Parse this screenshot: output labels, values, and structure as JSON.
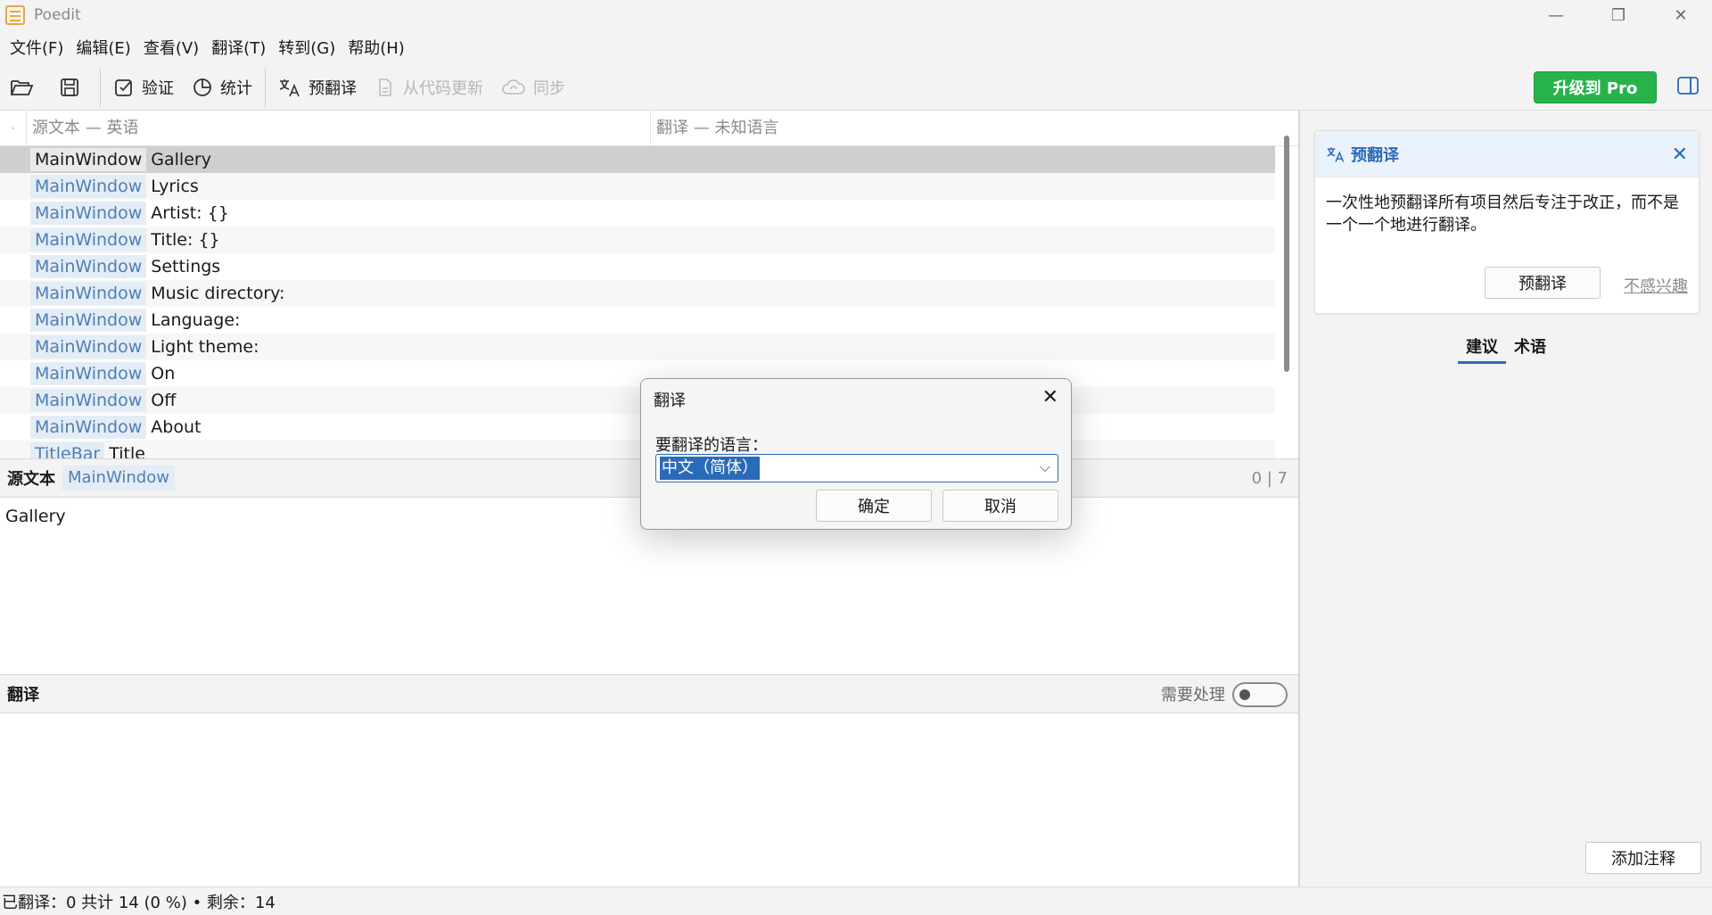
{
  "window": {
    "title": "Poedit",
    "minimize_glyph": "—",
    "restore_glyph": "❐",
    "close_glyph": "✕"
  },
  "menu": [
    {
      "label": "文件(F)"
    },
    {
      "label": "编辑(E)"
    },
    {
      "label": "查看(V)"
    },
    {
      "label": "翻译(T)"
    },
    {
      "label": "转到(G)"
    },
    {
      "label": "帮助(H)"
    }
  ],
  "toolbar": {
    "validate": "验证",
    "stats": "统计",
    "pretranslate": "预翻译",
    "update_from_code": "从代码更新",
    "sync": "同步",
    "upgrade": "升级到 Pro"
  },
  "list": {
    "dot": "·",
    "col_source": "源文本 — 英语",
    "col_translation": "翻译 — 未知语言",
    "rows": [
      {
        "context": "MainWindow",
        "source": "Gallery"
      },
      {
        "context": "MainWindow",
        "source": "Lyrics"
      },
      {
        "context": "MainWindow",
        "source": "Artist: {}"
      },
      {
        "context": "MainWindow",
        "source": "Title: {}"
      },
      {
        "context": "MainWindow",
        "source": "Settings"
      },
      {
        "context": "MainWindow",
        "source": "Music directory:"
      },
      {
        "context": "MainWindow",
        "source": "Language:"
      },
      {
        "context": "MainWindow",
        "source": "Light theme:"
      },
      {
        "context": "MainWindow",
        "source": "On"
      },
      {
        "context": "MainWindow",
        "source": "Off"
      },
      {
        "context": "MainWindow",
        "source": "About"
      },
      {
        "context": "TitleBar",
        "source": "Title"
      }
    ]
  },
  "source_panel": {
    "label": "源文本",
    "context": "MainWindow",
    "count": "0 | 7",
    "text": "Gallery"
  },
  "translation_panel": {
    "label": "翻译",
    "needs_work": "需要处理"
  },
  "sidebar": {
    "card_title": "预翻译",
    "card_close": "✕",
    "card_text": "一次性地预翻译所有项目然后专注于改正，而不是一个一个地进行翻译。",
    "card_button": "预翻译",
    "card_dismiss": "不感兴趣",
    "tab_suggestions": "建议",
    "tab_terms": "术语",
    "add_comment": "添加注释"
  },
  "status": {
    "text": "已翻译：0 共计 14 (0 %) • 剩余：14"
  },
  "dialog": {
    "title": "翻译",
    "close": "✕",
    "label": "要翻译的语言：",
    "selected_language": "中文（简体）",
    "arrow": "⌵",
    "ok": "确定",
    "cancel": "取消"
  },
  "colors": {
    "accent": "#2a6bb8",
    "pro_green": "#27b34a",
    "context_bg": "#e4ecf6",
    "context_fg": "#4e7fb3"
  }
}
